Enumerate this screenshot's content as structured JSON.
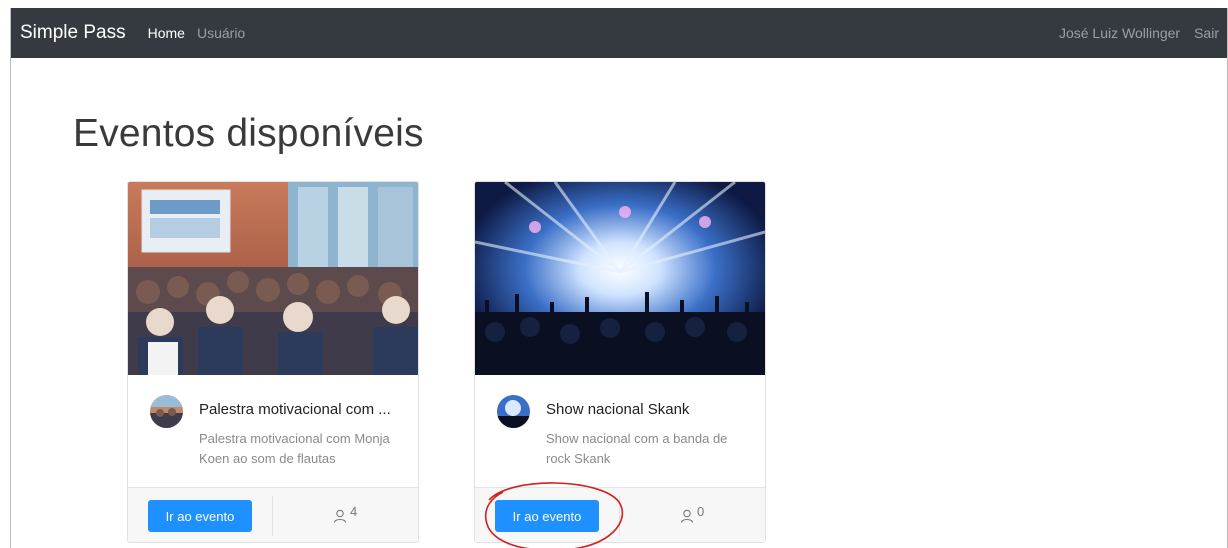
{
  "navbar": {
    "brand": "Simple Pass",
    "links": [
      {
        "label": "Home",
        "active": true
      },
      {
        "label": "Usuário",
        "active": false
      }
    ],
    "user_name": "José Luiz Wollinger",
    "logout": "Sair",
    "background": "#343a40"
  },
  "page": {
    "title": "Eventos disponíveis"
  },
  "events": [
    {
      "title": "Palestra motivacional com ...",
      "description": "Palestra motivacional com Monja Koen ao som de flautas",
      "button": "Ir ao evento",
      "attendees": "4",
      "image": "conference-audience-photo"
    },
    {
      "title": "Show nacional Skank",
      "description": "Show nacional com a banda de rock Skank",
      "button": "Ir ao evento",
      "attendees": "0",
      "image": "concert-stage-lights-photo"
    }
  ],
  "colors": {
    "primary_button": "#1e90ff",
    "annotation": "#d32020"
  }
}
